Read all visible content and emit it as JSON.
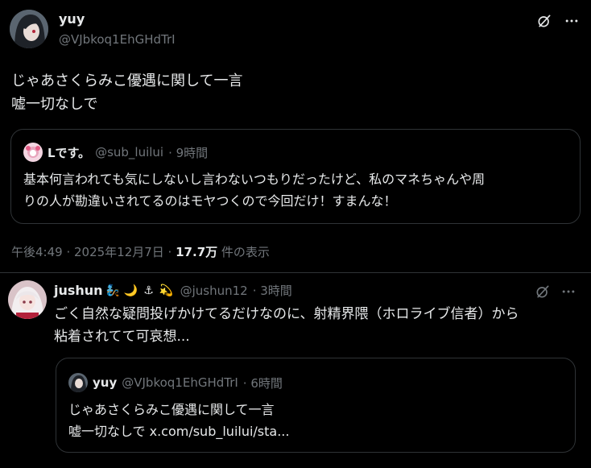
{
  "tweet": {
    "author_name": "yuy",
    "author_handle": "@VJbkoq1EhGHdTrI",
    "text_line1": "じゃあさくらみこ優遇に関して一言",
    "text_line2": "嘘一切なしで",
    "quote": {
      "name": "Lです。",
      "handle": "@sub_luilui",
      "time": "· 9時間",
      "text_line1": "基本何言われても気にしないし言わないつもりだったけど、私のマネちゃんや周",
      "text_line2": "りの人が勘違いされてるのはモヤつくので今回だけ！すまんな！"
    },
    "timestamp": "午後4:49 · 2025年12月7日 ·",
    "views_count": "17.7万",
    "views_label": "件の表示"
  },
  "reply": {
    "author_name": "jushun",
    "author_handle": "@jushun12",
    "time": "· 3時間",
    "emojis": [
      "🧞",
      "🌙",
      "⚓",
      "💫"
    ],
    "text_line1": "ごく自然な疑問投げかけてるだけなのに、射精界隈（ホロライブ信者）から",
    "text_line2": "粘着されてて可哀想...",
    "quote": {
      "name": "yuy",
      "handle": "@VJbkoq1EhGHdTrI",
      "time": "· 6時間",
      "text_line1": "じゃあさくらみこ優遇に関して一言",
      "text_line2": "嘘一切なしで x.com/sub_luilui/sta..."
    }
  },
  "icons": {
    "grok": "grok-icon",
    "more": "more-icon"
  },
  "colors": {
    "background": "#000000",
    "text": "#e7e9ea",
    "muted": "#71767b",
    "border": "#2f3336"
  }
}
